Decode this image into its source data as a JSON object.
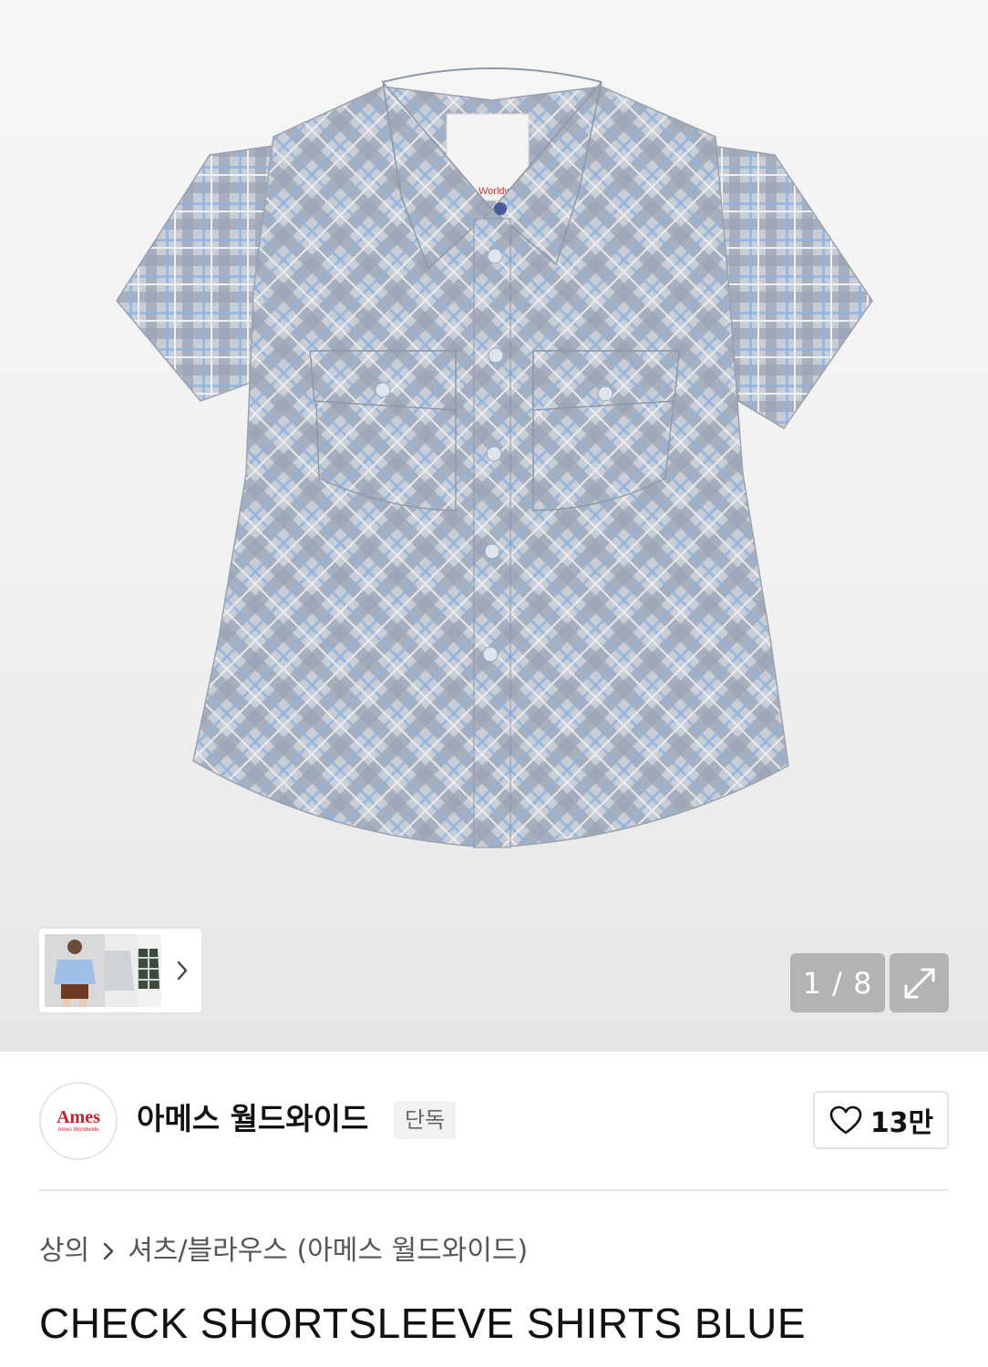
{
  "gallery": {
    "current": 1,
    "total": 8,
    "counter_text": "1 / 8",
    "thumbnails": [
      "model-front-shirt",
      "shirt-grey-variant",
      "shirt-dark-check-variant"
    ],
    "next_icon": "chevron-right-icon",
    "expand_icon": "expand-arrows-icon"
  },
  "brand": {
    "logo_text": "Ames",
    "logo_subtext": "Ames Worldwide",
    "name": "아메스 월드와이드",
    "badge": "단독",
    "accent_color": "#cc1f2b"
  },
  "like": {
    "icon": "heart-outline-icon",
    "count": "13만"
  },
  "breadcrumb": {
    "level1": "상의",
    "level2": "셔츠/블라우스 (아메스 월드와이드)"
  },
  "product": {
    "title": "CHECK SHORTSLEEVE SHIRTS BLUE",
    "label_text": "Ames Worldwide"
  }
}
